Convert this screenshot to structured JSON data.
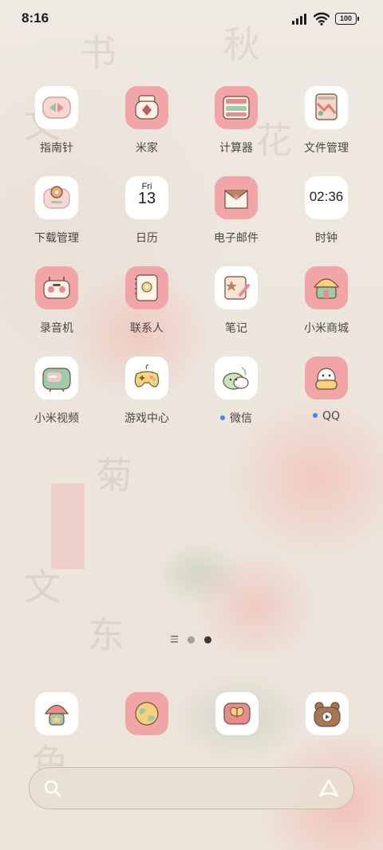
{
  "status_bar": {
    "time": "8:16",
    "battery": "100"
  },
  "apps": [
    {
      "label": "指南针",
      "icon": "compass-icon"
    },
    {
      "label": "米家",
      "icon": "mijia-icon"
    },
    {
      "label": "计算器",
      "icon": "calculator-icon"
    },
    {
      "label": "文件管理",
      "icon": "file-manager-icon"
    },
    {
      "label": "下载管理",
      "icon": "download-manager-icon"
    },
    {
      "label": "日历",
      "icon": "calendar-icon",
      "day": "Fri",
      "date": "13"
    },
    {
      "label": "电子邮件",
      "icon": "email-icon"
    },
    {
      "label": "时钟",
      "icon": "clock-icon",
      "time": "02:36"
    },
    {
      "label": "录音机",
      "icon": "recorder-icon"
    },
    {
      "label": "联系人",
      "icon": "contacts-icon"
    },
    {
      "label": "笔记",
      "icon": "notes-icon"
    },
    {
      "label": "小米商城",
      "icon": "mi-store-icon"
    },
    {
      "label": "小米视频",
      "icon": "mi-video-icon"
    },
    {
      "label": "游戏中心",
      "icon": "game-center-icon"
    },
    {
      "label": "微信",
      "icon": "wechat-icon",
      "new_badge": true
    },
    {
      "label": "QQ",
      "icon": "qq-icon",
      "new_badge": true
    }
  ],
  "page_indicator": {
    "pages": 2,
    "current": 2
  },
  "dock": [
    {
      "icon": "phone-mushroom-icon"
    },
    {
      "icon": "browser-globe-icon"
    },
    {
      "icon": "messages-butterfly-icon"
    },
    {
      "icon": "camera-bear-icon"
    }
  ],
  "colors": {
    "icon_pink": "#f1a5a6",
    "icon_white": "#ffffff",
    "badge_blue": "#3b86f5",
    "label_text": "#4b4642"
  }
}
